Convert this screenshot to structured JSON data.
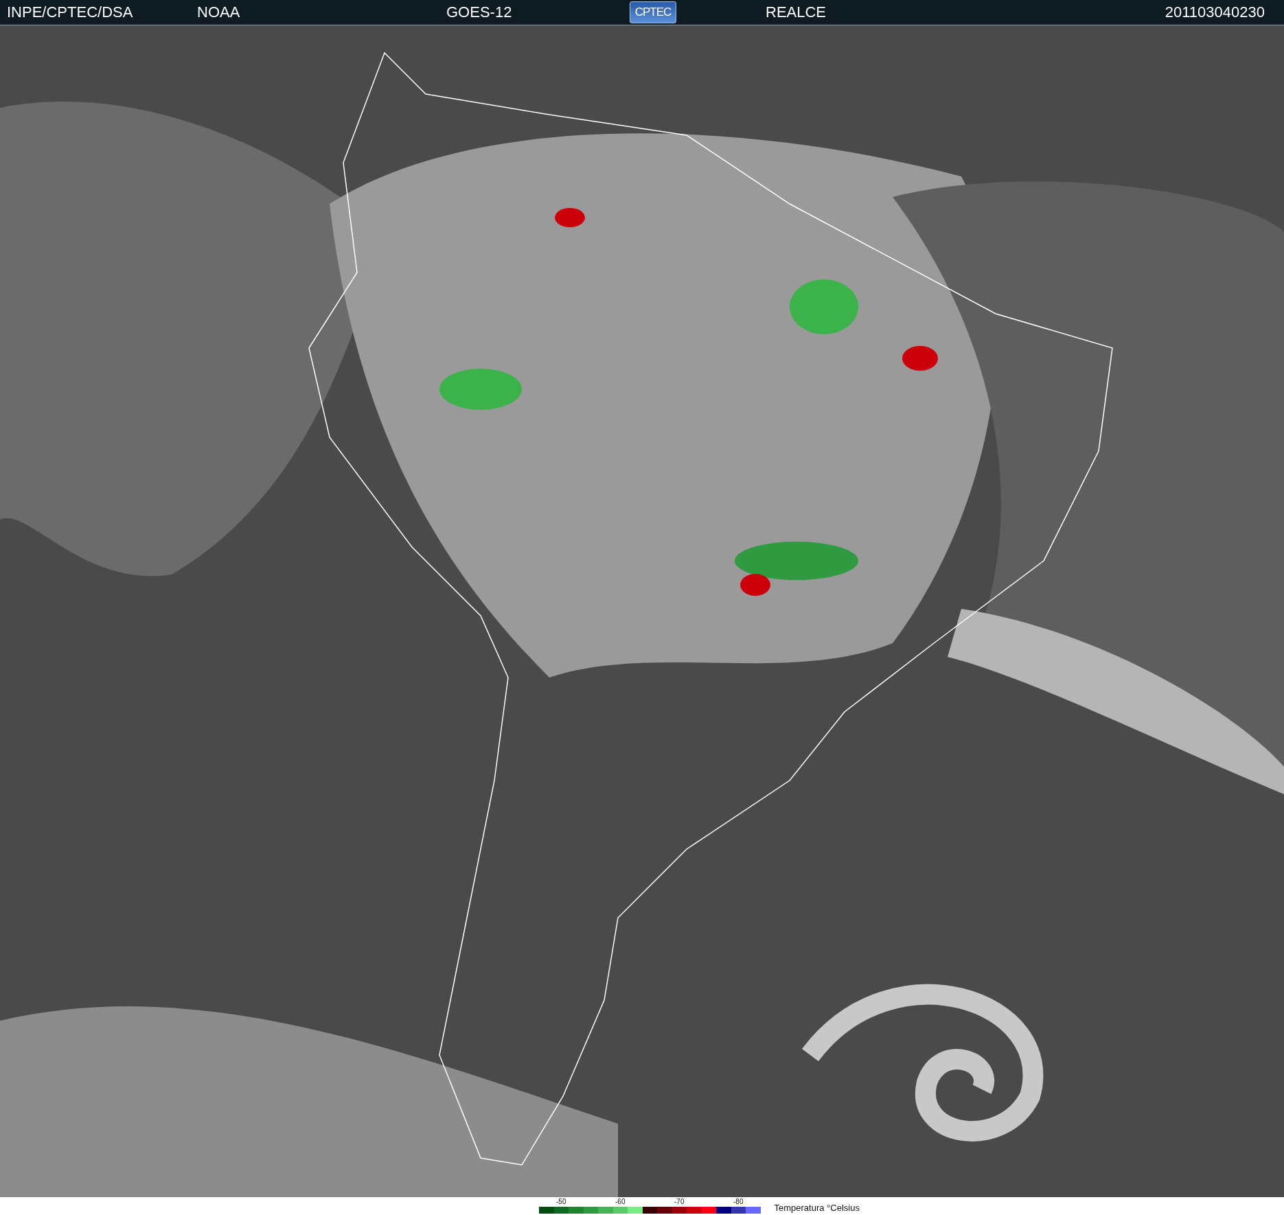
{
  "header": {
    "source": "INPE/CPTEC/DSA",
    "agency": "NOAA",
    "satellite": "GOES-12",
    "logo_text": "CPTEC",
    "product": "REALCE",
    "timestamp": "201103040230"
  },
  "legend": {
    "ticks": [
      "-50",
      "-60",
      "-70",
      "-80"
    ],
    "title": "Temperatura °Celsius",
    "swatches": [
      {
        "color": "#004d10"
      },
      {
        "color": "#0e6a22"
      },
      {
        "color": "#1f842f"
      },
      {
        "color": "#2f9a3f"
      },
      {
        "color": "#44b354"
      },
      {
        "color": "#5acb68"
      },
      {
        "color": "#76ec82"
      },
      {
        "color": "#3a0006"
      },
      {
        "color": "#6a0008"
      },
      {
        "color": "#9a0008"
      },
      {
        "color": "#cc000a"
      },
      {
        "color": "#ff0012"
      },
      {
        "color": "#000080"
      },
      {
        "color": "#3535b0"
      },
      {
        "color": "#6868ff"
      }
    ]
  }
}
